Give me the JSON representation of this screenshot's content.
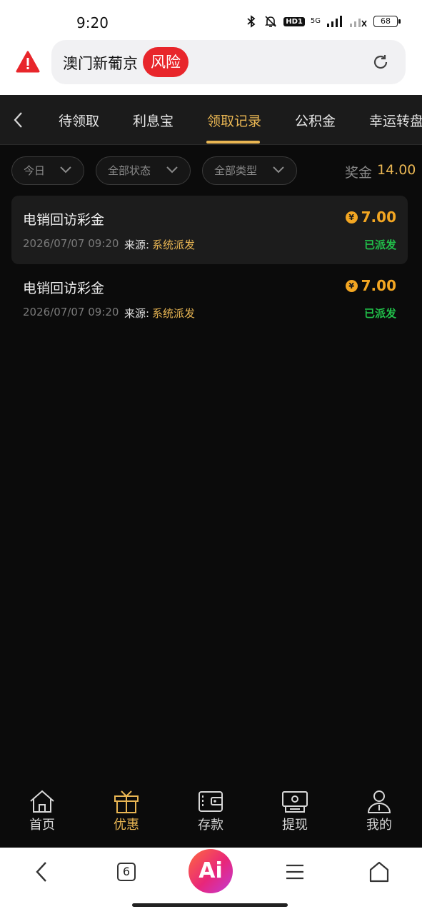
{
  "status_bar": {
    "time": "9:20",
    "hd_badge": "HD1",
    "network": "5G",
    "battery": "68",
    "icons": [
      "bluetooth-icon",
      "mute-bell-icon",
      "signal-icon",
      "wifi-off-icon",
      "battery-icon"
    ]
  },
  "browser": {
    "url_title": "澳门新葡京",
    "risk_label": "风险",
    "tab_count": "6",
    "ai_label": "Ai"
  },
  "tabs": [
    {
      "label": "待领取"
    },
    {
      "label": "利息宝"
    },
    {
      "label": "领取记录"
    },
    {
      "label": "公积金"
    },
    {
      "label": "幸运转盘"
    }
  ],
  "active_tab": "领取记录",
  "filters": {
    "date": "今日",
    "status": "全部状态",
    "type": "全部类型"
  },
  "summary": {
    "label": "奖金",
    "value": "14.00"
  },
  "records": [
    {
      "title": "电销回访彩金",
      "amount": "7.00",
      "currency_symbol": "¥",
      "datetime": "2026/07/07 09:20",
      "source_label": "来源:",
      "source": "系统派发",
      "status": "已派发"
    },
    {
      "title": "电销回访彩金",
      "amount": "7.00",
      "currency_symbol": "¥",
      "datetime": "2026/07/07 09:20",
      "source_label": "来源:",
      "source": "系统派发",
      "status": "已派发"
    }
  ],
  "app_nav": [
    {
      "label": "首页",
      "icon": "home-icon"
    },
    {
      "label": "优惠",
      "icon": "gift-icon"
    },
    {
      "label": "存款",
      "icon": "wallet-icon"
    },
    {
      "label": "提现",
      "icon": "cash-icon"
    },
    {
      "label": "我的",
      "icon": "profile-icon"
    }
  ],
  "active_nav": "优惠",
  "colors": {
    "accent_gold": "#e9b653",
    "amount_orange": "#f3a622",
    "status_green": "#21c04a",
    "risk_red": "#e8262b",
    "background": "#0b0b0b"
  }
}
